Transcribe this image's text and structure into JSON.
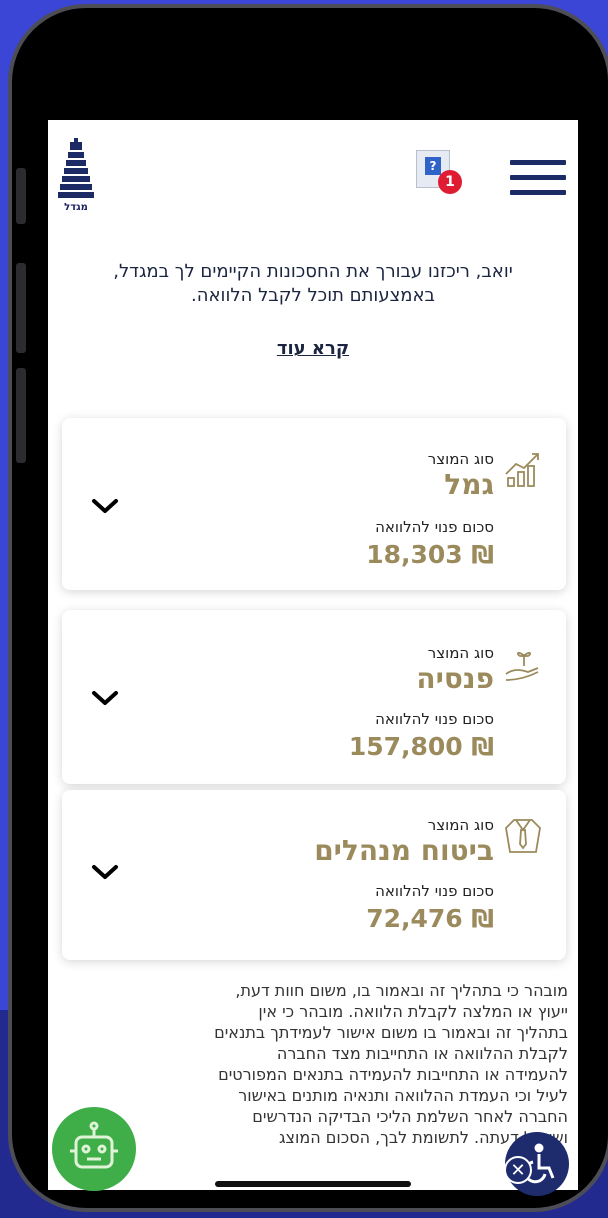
{
  "header": {
    "logo_text": "מגדל",
    "notification_count": "1",
    "notification_glyph": "?"
  },
  "intro": {
    "line1": "יואב, ריכזנו עבורך את החסכונות הקיימים לך במגדל,",
    "line2": "באמצעותם תוכל לקבל הלוואה.",
    "read_more": "קרא עוד"
  },
  "products": [
    {
      "type_label": "סוג המוצר",
      "type": "גמל",
      "amount_label": "סכום פנוי להלוואה",
      "amount": "18,303 ₪",
      "icon": "growth-chart-icon"
    },
    {
      "type_label": "סוג המוצר",
      "type": "פנסיה",
      "amount_label": "סכום פנוי להלוואה",
      "amount": "157,800 ₪",
      "icon": "hand-seedling-icon"
    },
    {
      "type_label": "סוג המוצר",
      "type": "ביטוח מנהלים",
      "amount_label": "סכום פנוי להלוואה",
      "amount": "72,476 ₪",
      "icon": "shirt-tie-icon"
    }
  ],
  "disclaimer": {
    "lines": [
      "מובהר כי בתהליך זה ובאמור בו, משום חוות דעת,",
      "ייעוץ או המלצה לקבלת הלוואה. מובהר כי אין",
      "בתהליך זה ובאמור בו משום אישור לעמידתך בתנאים",
      "לקבלת ההלוואה או התחייבות מצד החברה",
      "להעמידה או התחייבות להעמידה בתנאים המפורטים",
      "לעיל וכי העמדת ההלוואה ותנאיה מותנים באישור",
      "החברה לאחר השלמת הליכי הבדיקה הנדרשים",
      "ושיקול דעתה. לתשומת לבך, הסכום המוצג"
    ]
  },
  "colors": {
    "brand_navy": "#1c2a66",
    "gold": "#9b8a5c",
    "badge_red": "#e01c33",
    "bot_green": "#3fae49",
    "background_blue": "#3b46d6"
  },
  "widgets": {
    "chatbot_icon": "robot-icon",
    "accessibility_icon": "wheelchair-icon",
    "close_glyph": "✕"
  }
}
